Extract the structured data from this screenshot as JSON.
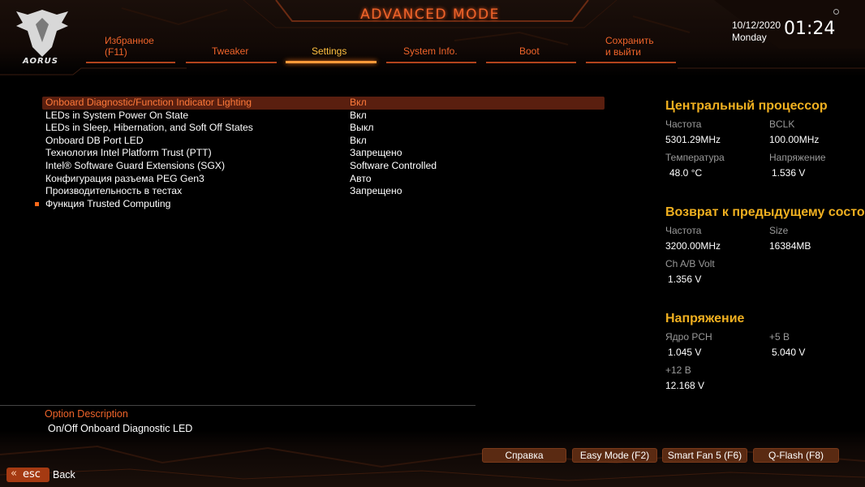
{
  "header": {
    "title": "ADVANCED MODE",
    "logo_text": "AORUS",
    "date": "10/12/2020",
    "weekday": "Monday",
    "time": "01:24"
  },
  "tabs": [
    {
      "label": "Избранное\n(F11)",
      "active": false
    },
    {
      "label": "Tweaker",
      "active": false
    },
    {
      "label": "Settings",
      "active": true
    },
    {
      "label": "System Info.",
      "active": false
    },
    {
      "label": "Boot",
      "active": false
    },
    {
      "label": "Сохранить\nи выйти",
      "active": false
    }
  ],
  "settings": {
    "rows": [
      {
        "name": "Onboard Diagnostic/Function Indicator Lighting",
        "value": "Вкл",
        "selected": true
      },
      {
        "name": "LEDs in System Power On State",
        "value": "Вкл"
      },
      {
        "name": "LEDs in Sleep, Hibernation, and Soft Off States",
        "value": "Выкл"
      },
      {
        "name": "Onboard DB Port LED",
        "value": "Вкл"
      },
      {
        "name": "Технология Intel Platform Trust (PTT)",
        "value": "Запрещено"
      },
      {
        "name": "Intel® Software Guard Extensions (SGX)",
        "value": "Software Controlled"
      },
      {
        "name": "Конфигурация разъема PEG Gen3",
        "value": "Авто"
      },
      {
        "name": "Производительность в тестах",
        "value": "Запрещено"
      },
      {
        "name": "Функция Trusted Computing",
        "value": "",
        "submenu": true
      }
    ]
  },
  "description": {
    "title": "Option Description",
    "text": "On/Off Onboard Diagnostic LED"
  },
  "cpu": {
    "title": "Центральный процессор",
    "freq_label": "Частота",
    "freq_value": "5301.29MHz",
    "bclk_label": "BCLK",
    "bclk_value": "100.00MHz",
    "temp_label": "Температура",
    "temp_value": "48.0 °C",
    "volt_label": "Напряжение",
    "volt_value": "1.536 V"
  },
  "memory": {
    "title": "Возврат к предыдущему состо",
    "freq_label": "Частота",
    "freq_value": "3200.00MHz",
    "size_label": "Size",
    "size_value": "16384MB",
    "volt_label": "Ch A/B Volt",
    "volt_value": "1.356 V"
  },
  "voltage": {
    "title": "Напряжение",
    "pch_label": "Ядро PCH",
    "pch_value": "1.045 V",
    "v5_label": "+5 В",
    "v5_value": "5.040 V",
    "v12_label": "+12 В",
    "v12_value": "12.168 V"
  },
  "buttons": {
    "help": "Справка",
    "easy": "Easy Mode (F2)",
    "fan": "Smart Fan 5 (F6)",
    "qflash": "Q-Flash (F8)"
  },
  "footer": {
    "esc": "esc",
    "back": "Back"
  },
  "colors": {
    "accent": "#f0642a",
    "active_tab": "#ffc040",
    "side_title": "#f0b020",
    "selected_row": "#5a1f0f"
  }
}
